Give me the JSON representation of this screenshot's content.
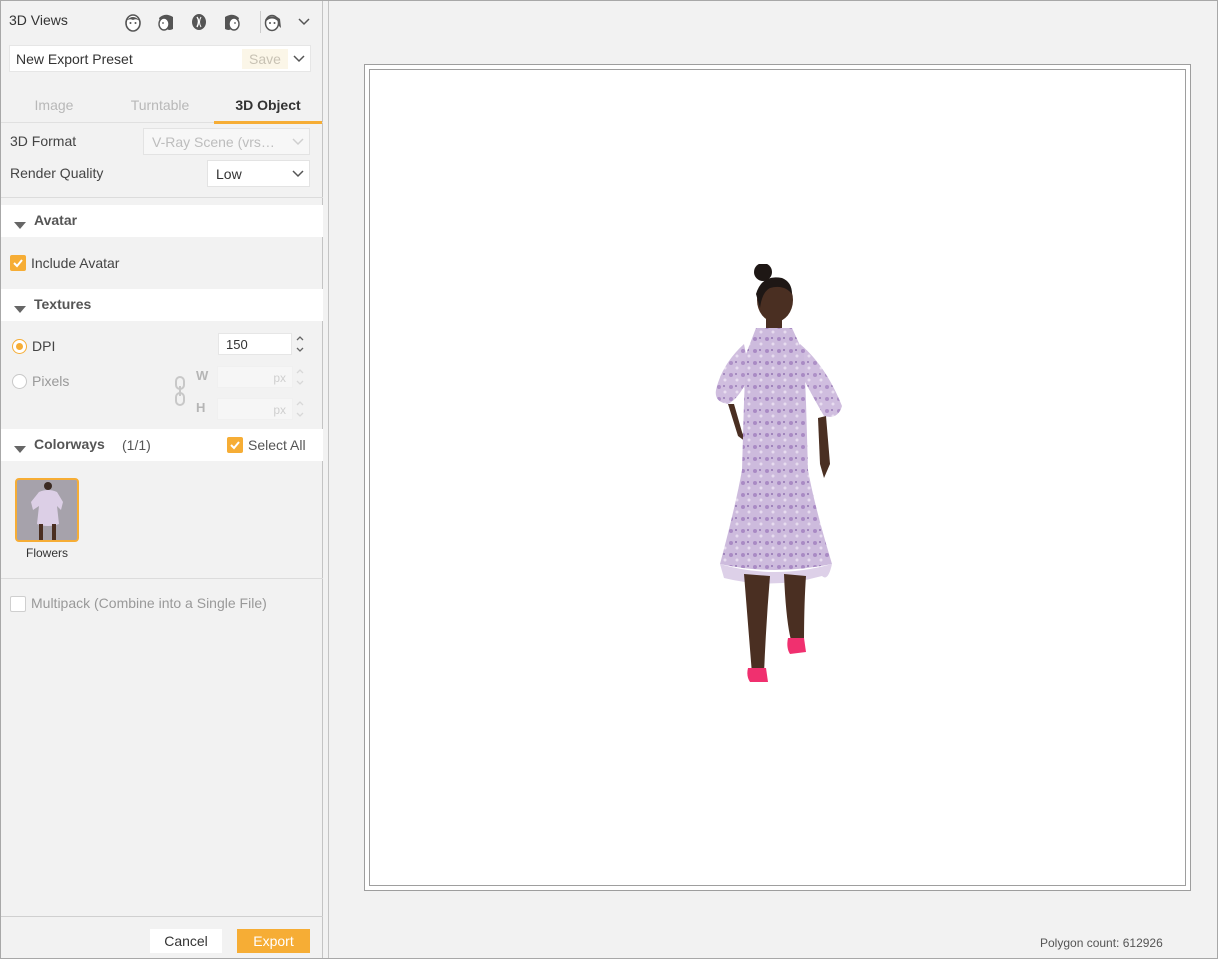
{
  "panel": {
    "views_title": "3D Views",
    "view_icons": [
      "front-face-icon",
      "side-face-left-icon",
      "back-head-icon",
      "side-face-right-icon",
      "three-quarter-face-icon"
    ],
    "preset": {
      "name": "New Export Preset",
      "save_label": "Save"
    },
    "tabs": [
      {
        "label": "Image",
        "active": false
      },
      {
        "label": "Turntable",
        "active": false
      },
      {
        "label": "3D Object",
        "active": true
      }
    ],
    "format_label": "3D Format",
    "format_value": "V-Ray Scene (vrs…",
    "quality_label": "Render Quality",
    "quality_value": "Low",
    "avatar_section": "Avatar",
    "include_avatar_label": "Include Avatar",
    "include_avatar_checked": true,
    "textures_section": "Textures",
    "dpi_label": "DPI",
    "dpi_value": "150",
    "pixels_label": "Pixels",
    "w_label": "W",
    "h_label": "H",
    "px_unit": "px",
    "colorways_section": "Colorways",
    "colorways_count": "(1/1)",
    "select_all_label": "Select All",
    "colorway_name": "Flowers",
    "multipack_label": "Multipack (Combine into a Single File)",
    "cancel_label": "Cancel",
    "export_label": "Export"
  },
  "preview": {
    "polygon_count": "Polygon count: 612926"
  },
  "colors": {
    "accent": "#f6ad35",
    "panel_bg": "#f2f2f2",
    "dress": "#c9b6d9",
    "shoes": "#f0306f",
    "skin": "#5a3a2a"
  }
}
